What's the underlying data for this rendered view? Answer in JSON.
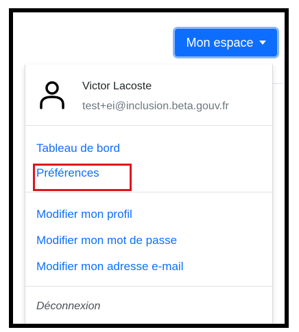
{
  "header": {
    "button_label": "Mon espace"
  },
  "user": {
    "name": "Victor Lacoste",
    "email": "test+ei@inclusion.beta.gouv.fr",
    "avatar_icon": "user-icon"
  },
  "menu": {
    "section1": [
      "Tableau de bord",
      "Préférences"
    ],
    "section2": [
      "Modifier mon profil",
      "Modifier mon mot de passe",
      "Modifier mon adresse e-mail"
    ],
    "logout": "Déconnexion"
  },
  "colors": {
    "primary": "#0d6efd",
    "highlight": "#e0131d",
    "frame": "#000000"
  }
}
